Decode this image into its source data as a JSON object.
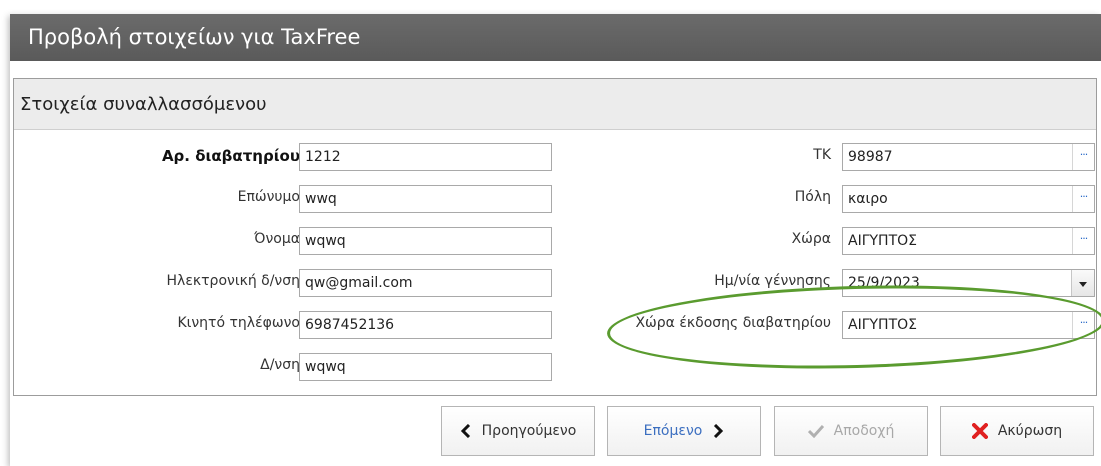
{
  "window": {
    "title": "Προβολή στοιχείων για TaxFree"
  },
  "section": {
    "title": "Στοιχεία συναλλασσόμενου"
  },
  "left_fields": [
    {
      "label": "Αρ. διαβατηρίου",
      "value": "1212"
    },
    {
      "label": "Επώνυμο",
      "value": "wwq"
    },
    {
      "label": "Όνομα",
      "value": "wqwq"
    },
    {
      "label": "Ηλεκτρονική δ/νση",
      "value": "qw@gmail.com"
    },
    {
      "label": "Κινητό τηλέφωνο",
      "value": "6987452136"
    },
    {
      "label": "Δ/νση",
      "value": "wqwq"
    }
  ],
  "right_fields": [
    {
      "label": "ΤΚ",
      "value": "98987",
      "control": "lookup"
    },
    {
      "label": "Πόλη",
      "value": "καιρο",
      "control": "lookup"
    },
    {
      "label": "Χώρα",
      "value": "ΑΙΓΥΠΤΟΣ",
      "control": "lookup"
    },
    {
      "label": "Ημ/νία γέννησης",
      "value": "25/9/2023",
      "control": "dropdown"
    },
    {
      "label": "Χώρα έκδοσης διαβατηρίου",
      "value": "ΑΙΓΥΠΤΟΣ",
      "control": "lookup"
    }
  ],
  "lookup_glyph": "···",
  "buttons": {
    "previous": "Προηγούμενο",
    "next": "Επόμενο",
    "accept": "Αποδοχή",
    "cancel": "Ακύρωση"
  },
  "colors": {
    "titlebar": "#5f5f5f",
    "highlight_ellipse": "#5a9b2f",
    "cancel_icon": "#e02020",
    "lookup_button": "#2a6ac8"
  }
}
